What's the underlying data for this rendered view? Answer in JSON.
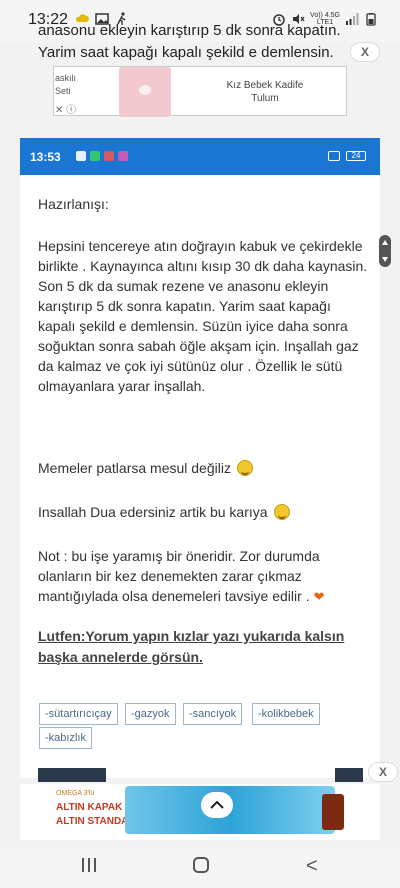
{
  "status_bar": {
    "time": "13:22",
    "network": "Vo)) 4.5G\nLTE1"
  },
  "background": {
    "line1": "anasonu ekleyin karıştırıp 5 dk sonra kapatın.",
    "line2": "Yarim saat kapağı kapalı şekild e demlensin."
  },
  "top_ad": {
    "left_line1": "askılı",
    "left_line2": "Seti",
    "title_line1": "Kız Bebek Kadife",
    "title_line2": "Tulum",
    "close": "X"
  },
  "inner_status": {
    "time": "13:53",
    "right_indicator": "24"
  },
  "post": {
    "heading": "Hazırlanışı:",
    "recipe": "Hepsini tencereye atın doğrayın kabuk ve çekirdekle birlikte . Kaynayınca altını kısıp 30 dk daha kaynasin. Son 5 dk da sumak rezene ve anasonu ekleyin karıştırıp 5 dk sonra kapatın. Yarim saat kapağı kapalı şekild e demlensin. Süzün iyice daha sonra soğuktan sonra sabah öğle akşam için.  Inşallah gaz da kalmaz ve çok iyi sütünüz olur . Özellik le sütü olmayanlara yarar inşallah.",
    "line_memeler": "Memeler patlarsa mesul değiliz",
    "line_dua": "Insallah Dua edersiniz artik bu karıya",
    "note": "Not : bu işe yaramış bir öneridir.  Zor durumda olanların bir kez denemekten zarar çıkmaz mantığıylada olsa denemeleri tavsiye edilir .",
    "link": "Lutfen:Yorum yapın kızlar yazı yukarıda kalsın başka annelerde görsün."
  },
  "tags": [
    "-sütartırıcıçay",
    "-gazyok",
    "-sancıyok",
    "-kolikbebek",
    "-kabızlık"
  ],
  "bottom_ad": {
    "brand_small": "OMEGA 3'lü",
    "line1": "ALTIN KAPAK",
    "line2": "ALTIN STANDART",
    "up_arrow": "^",
    "close": "X"
  },
  "nav": {
    "back": "<"
  },
  "colors": {
    "accent": "#1976d2",
    "tag_border": "#9bb8d3"
  }
}
